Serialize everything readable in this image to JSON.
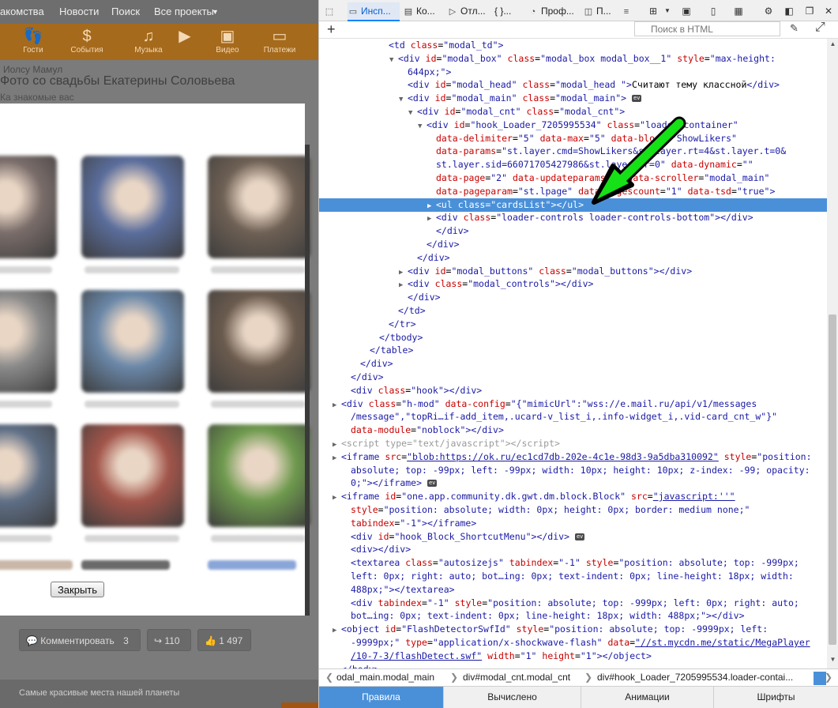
{
  "left_page": {
    "nav": [
      "акомства",
      "Новости",
      "Поиск",
      "Все проекты"
    ],
    "nav_dropdown_icon": "chevron-down-icon",
    "orange_bar": [
      {
        "icon": "footprints-icon",
        "label": "Гости"
      },
      {
        "icon": "dollar-icon",
        "label": "События"
      },
      {
        "icon": "music-note-icon",
        "label": "Музыка"
      },
      {
        "icon": "play-icon",
        "label": ""
      },
      {
        "icon": "camera-icon",
        "label": "Видео"
      },
      {
        "icon": "wallet-icon",
        "label": "Платежи"
      }
    ],
    "title1": "Иолсу Мамул",
    "title2": "Фото со свадьбы Екатерины Соловьева",
    "title3": "Ка знакомые вас",
    "modal": {
      "close_label": "Закрыть",
      "thumb_colors": [
        [
          "#7a6d6a",
          "#5a6d9c",
          "#6e6054"
        ],
        [
          "#8a8a8a",
          "#6a87a8",
          "#6b5b4e"
        ],
        [
          "#5f6f86",
          "#a2554a",
          "#6f9a4e"
        ]
      ]
    },
    "actions": {
      "comment_label": "Комментировать",
      "comment_count": "3",
      "share_count": "110",
      "like_count": "1 497"
    },
    "bottom_text": "Самые красивые места нашей планеты"
  },
  "devtools": {
    "tabs": [
      {
        "icon": "pick-element-icon",
        "label": ""
      },
      {
        "icon": "inspector-icon",
        "label": "Инсп..."
      },
      {
        "icon": "console-icon",
        "label": "Ко..."
      },
      {
        "icon": "debugger-icon",
        "label": "Отл..."
      },
      {
        "icon": "style-editor-icon",
        "label": "{ }..."
      },
      {
        "icon": "performance-icon",
        "label": "Проф..."
      },
      {
        "icon": "memory-icon",
        "label": "П..."
      },
      {
        "icon": "network-icon",
        "label": ""
      }
    ],
    "search_placeholder": "Поиск в HTML",
    "lines": [
      {
        "indent": 7,
        "tw": "",
        "html": "<span class='t'>&lt;td</span> <span class='a'>class</span>=<span class='v'>\"modal_td\"</span><span class='t'>&gt;</span>"
      },
      {
        "indent": 8,
        "tw": "▼",
        "html": "<span class='t'>&lt;div</span> <span class='a'>id</span>=<span class='v'>\"modal_box\"</span> <span class='a'>class</span>=<span class='v'>\"modal_box modal_box__1\"</span> <span class='a'>style</span>=<span class='v'>\"max-height:</span>"
      },
      {
        "indent": 9,
        "tw": "",
        "html": "<span class='v'>644px;\"</span><span class='t'>&gt;</span>"
      },
      {
        "indent": 9,
        "tw": "",
        "html": "<span class='t'>&lt;div</span> <span class='a'>id</span>=<span class='v'>\"modal_head\"</span> <span class='a'>class</span>=<span class='v'>\"modal_head \"</span><span class='t'>&gt;</span>Считают тему классной<span class='t'>&lt;/div&gt;</span>"
      },
      {
        "indent": 9,
        "tw": "▼",
        "html": "<span class='t'>&lt;div</span> <span class='a'>id</span>=<span class='v'>\"modal_main\"</span> <span class='a'>class</span>=<span class='v'>\"modal_main\"</span><span class='t'>&gt;</span> <span class='ev'>ev</span>"
      },
      {
        "indent": 10,
        "tw": "▼",
        "html": "<span class='t'>&lt;div</span> <span class='a'>id</span>=<span class='v'>\"modal_cnt\"</span> <span class='a'>class</span>=<span class='v'>\"modal_cnt\"</span><span class='t'>&gt;</span>"
      },
      {
        "indent": 11,
        "tw": "▼",
        "html": "<span class='t'>&lt;div</span> <span class='a'>id</span>=<span class='v'>\"hook_Loader_7205995534\"</span> <span class='a'>class</span>=<span class='v'>\"loader-container\"</span>"
      },
      {
        "indent": 12,
        "tw": "",
        "html": "<span class='a'>data-delimiter</span>=<span class='v'>\"5\"</span> <span class='a'>data-max</span>=<span class='v'>\"5\"</span> <span class='a'>data-block</span>=<span class='v'>\"ShowLikers\"</span>"
      },
      {
        "indent": 12,
        "tw": "",
        "html": "<span class='a'>data-params</span>=<span class='v'>\"st.layer.cmd=ShowLikers&amp;st.layer.rt=4&amp;st.layer.t=0&amp;</span>"
      },
      {
        "indent": 12,
        "tw": "",
        "html": "<span class='v'>st.layer.sid=66071705427986&amp;st.layer.tr=0\"</span> <span class='a'>data-dynamic</span>=<span class='v'>\"\"</span>"
      },
      {
        "indent": 12,
        "tw": "",
        "html": "<span class='a'>data-page</span>=<span class='v'>\"2\"</span> <span class='a'>data-updateparams</span>=<span class='v'>\"\"</span> <span class='a'>data-scroller</span>=<span class='v'>\"modal_main\"</span>"
      },
      {
        "indent": 12,
        "tw": "",
        "html": "<span class='a'>data-pageparam</span>=<span class='v'>\"st.lpage\"</span> <span class='a'>data-pagescount</span>=<span class='v'>\"1\"</span> <span class='a'>data-tsd</span>=<span class='v'>\"true\"</span><span class='t'>&gt;</span>"
      },
      {
        "indent": 12,
        "tw": "▶",
        "sel": true,
        "html": "<span class='t'>&lt;ul</span> <span class='a'>class</span>=<span class='v'>\"cardsList\"</span><span class='t'>&gt;&lt;/ul&gt;</span>"
      },
      {
        "indent": 12,
        "tw": "▶",
        "html": "<span class='t'>&lt;div</span> <span class='a'>class</span>=<span class='v'>\"loader-controls loader-controls-bottom\"</span><span class='t'>&gt;&lt;/div&gt;</span>"
      },
      {
        "indent": 12,
        "tw": "",
        "html": "<span class='t'>&lt;/div&gt;</span>"
      },
      {
        "indent": 11,
        "tw": "",
        "html": "<span class='t'>&lt;/div&gt;</span>"
      },
      {
        "indent": 10,
        "tw": "",
        "html": "<span class='t'>&lt;/div&gt;</span>"
      },
      {
        "indent": 9,
        "tw": "▶",
        "html": "<span class='t'>&lt;div</span> <span class='a'>id</span>=<span class='v'>\"modal_buttons\"</span> <span class='a'>class</span>=<span class='v'>\"modal_buttons\"</span><span class='t'>&gt;&lt;/div&gt;</span>"
      },
      {
        "indent": 9,
        "tw": "▶",
        "html": "<span class='t'>&lt;div</span> <span class='a'>class</span>=<span class='v'>\"modal_controls\"</span><span class='t'>&gt;&lt;/div&gt;</span>"
      },
      {
        "indent": 9,
        "tw": "",
        "html": "<span class='t'>&lt;/div&gt;</span>"
      },
      {
        "indent": 8,
        "tw": "",
        "html": "<span class='t'>&lt;/td&gt;</span>"
      },
      {
        "indent": 7,
        "tw": "",
        "html": "<span class='t'>&lt;/tr&gt;</span>"
      },
      {
        "indent": 6,
        "tw": "",
        "html": "<span class='t'>&lt;/tbody&gt;</span>"
      },
      {
        "indent": 5,
        "tw": "",
        "html": "<span class='t'>&lt;/table&gt;</span>"
      },
      {
        "indent": 4,
        "tw": "",
        "html": "<span class='t'>&lt;/div&gt;</span>"
      },
      {
        "indent": 3,
        "tw": "",
        "html": "<span class='t'>&lt;/div&gt;</span>"
      },
      {
        "indent": 3,
        "tw": "",
        "html": "<span class='t'>&lt;div</span> <span class='a'>class</span>=<span class='v'>\"hook\"</span><span class='t'>&gt;&lt;/div&gt;</span>"
      },
      {
        "indent": 2,
        "tw": "▶",
        "html": "<span class='t'>&lt;div</span> <span class='a'>class</span>=<span class='v'>\"h-mod\"</span> <span class='a'>data-config</span>=<span class='v'>\"{\"mimicUrl\":\"wss://e.mail.ru/api/v1/messages</span>"
      },
      {
        "indent": 3,
        "tw": "",
        "html": "<span class='v'>/message\",\"topRi…if-add_item,.ucard-v_list_i,.info-widget_i,.vid-card_cnt_w\"}\"</span>"
      },
      {
        "indent": 3,
        "tw": "",
        "html": "<span class='a'>data-module</span>=<span class='v'>\"noblock\"</span><span class='t'>&gt;&lt;/div&gt;</span>"
      },
      {
        "indent": 2,
        "tw": "▶",
        "html": "<span class='gray'>&lt;script type=\"text/javascript\"&gt;&lt;/script&gt;</span>"
      },
      {
        "indent": 2,
        "tw": "▶",
        "html": "<span class='t'>&lt;iframe</span> <span class='a'>src</span>=<span class='u'>\"blob:https://ok.ru/ec1cd7db-202e-4c1e-98d3-9a5dba310092\"</span> <span class='a'>style</span>=<span class='v'>\"position:</span>"
      },
      {
        "indent": 3,
        "tw": "",
        "html": "<span class='v'>absolute; top: -99px; left: -99px; width: 10px; height: 10px; z-index: -99; opacity:</span>"
      },
      {
        "indent": 3,
        "tw": "",
        "html": "<span class='v'>0;\"</span><span class='t'>&gt;&lt;/iframe&gt;</span> <span class='ev'>ev</span>"
      },
      {
        "indent": 2,
        "tw": "▶",
        "html": "<span class='t'>&lt;iframe</span> <span class='a'>id</span>=<span class='v'>\"one.app.community.dk.gwt.dm.block.Block\"</span> <span class='a'>src</span>=<span class='u'>\"javascript:''\"</span>"
      },
      {
        "indent": 3,
        "tw": "",
        "html": "<span class='a'>style</span>=<span class='v'>\"position: absolute; width: 0px; height: 0px; border: medium none;\"</span>"
      },
      {
        "indent": 3,
        "tw": "",
        "html": "<span class='a'>tabindex</span>=<span class='v'>\"-1\"</span><span class='t'>&gt;&lt;/iframe&gt;</span>"
      },
      {
        "indent": 3,
        "tw": "",
        "html": "<span class='t'>&lt;div</span> <span class='a'>id</span>=<span class='v'>\"hook_Block_ShortcutMenu\"</span><span class='t'>&gt;&lt;/div&gt;</span> <span class='ev'>ev</span>"
      },
      {
        "indent": 3,
        "tw": "",
        "html": "<span class='t'>&lt;div&gt;&lt;/div&gt;</span>"
      },
      {
        "indent": 3,
        "tw": "",
        "html": "<span class='t'>&lt;textarea</span> <span class='a'>class</span>=<span class='v'>\"autosizejs\"</span> <span class='a'>tabindex</span>=<span class='v'>\"-1\"</span> <span class='a'>style</span>=<span class='v'>\"position: absolute; top: -999px;</span>"
      },
      {
        "indent": 3,
        "tw": "",
        "html": "<span class='v'>left: 0px; right: auto; bot…ing: 0px; text-indent: 0px; line-height: 18px; width:</span>"
      },
      {
        "indent": 3,
        "tw": "",
        "html": "<span class='v'>488px;\"</span><span class='t'>&gt;&lt;/textarea&gt;</span>"
      },
      {
        "indent": 3,
        "tw": "",
        "html": "<span class='t'>&lt;div</span> <span class='a'>tabindex</span>=<span class='v'>\"-1\"</span> <span class='a'>style</span>=<span class='v'>\"position: absolute; top: -999px; left: 0px; right: auto;</span>"
      },
      {
        "indent": 3,
        "tw": "",
        "html": "<span class='v'>bot…ing: 0px; text-indent: 0px; line-height: 18px; width: 488px;\"</span><span class='t'>&gt;&lt;/div&gt;</span>"
      },
      {
        "indent": 2,
        "tw": "▶",
        "html": "<span class='t'>&lt;object</span> <span class='a'>id</span>=<span class='v'>\"FlashDetectorSwfId\"</span> <span class='a'>style</span>=<span class='v'>\"position: absolute; top: -9999px; left:</span>"
      },
      {
        "indent": 3,
        "tw": "",
        "html": "<span class='v'>-9999px;\"</span> <span class='a'>type</span>=<span class='v'>\"application/x-shockwave-flash\"</span> <span class='a'>data</span>=<span class='u'>\"//st.mycdn.me/static/MegaPlayer</span>"
      },
      {
        "indent": 3,
        "tw": "",
        "html": "<span class='u'>/10-7-3/flashDetect.swf\"</span> <span class='a'>width</span>=<span class='v'>\"1\"</span> <span class='a'>height</span>=<span class='v'>\"1\"</span><span class='t'>&gt;&lt;/object&gt;</span>"
      },
      {
        "indent": 2,
        "tw": "",
        "html": "<span class='t'>&lt;/body&gt;</span>"
      }
    ],
    "breadcrumbs": [
      "odal_main.modal_main",
      "div#modal_cnt.modal_cnt",
      "div#hook_Loader_7205995534.loader-contai..."
    ],
    "bottom_tabs": [
      {
        "label": "Правила",
        "active": true
      },
      {
        "label": "Вычислено",
        "active": false
      },
      {
        "label": "Анимации",
        "active": false
      },
      {
        "label": "Шрифты",
        "active": false
      }
    ],
    "colors": {
      "selection": "#4a90d9",
      "arrow": "#16e016",
      "tag": "#1a1aa6",
      "attr": "#c80000"
    }
  }
}
